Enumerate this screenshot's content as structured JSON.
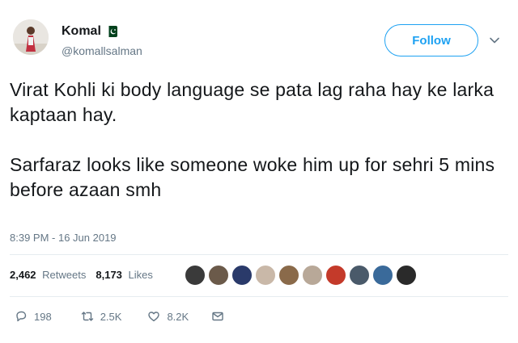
{
  "user": {
    "display_name": "Komal",
    "handle": "@komallsalman",
    "flag_icon": "pakistan-flag-icon"
  },
  "follow_label": "Follow",
  "tweet": {
    "paragraph_1": "Virat Kohli ki body language se pata lag raha hay ke larka kaptaan hay.",
    "paragraph_2": "Sarfaraz looks like someone woke him up for sehri 5 mins before azaan smh"
  },
  "timestamp": "8:39 PM - 16 Jun 2019",
  "stats": {
    "retweets_count": "2,462",
    "retweets_label": "Retweets",
    "likes_count": "8,173",
    "likes_label": "Likes"
  },
  "likers": [
    "#3a3a3a",
    "#6b5a4a",
    "#2a3a6a",
    "#c9b8a8",
    "#8a6a4a",
    "#b8a898",
    "#c43a2a",
    "#4a5a6a",
    "#3a6a9a",
    "#2a2a2a"
  ],
  "actions": {
    "replies": "198",
    "retweets": "2.5K",
    "likes": "8.2K"
  },
  "colors": {
    "accent": "#1da1f2",
    "secondary_text": "#657786",
    "flag_green": "#01411c"
  }
}
